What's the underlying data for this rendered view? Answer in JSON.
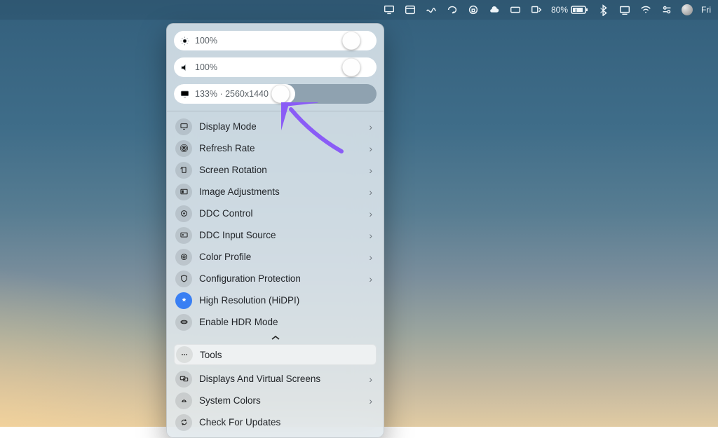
{
  "menubar": {
    "battery_percent": "80%",
    "time_label": "Fri"
  },
  "sliders": {
    "brightness": {
      "value_label": "100%",
      "knob_pct": 92
    },
    "volume": {
      "value_label": "100%",
      "knob_pct": 92
    },
    "resolution": {
      "value_label": "133% · 2560x1440",
      "knob_pct": 57,
      "fill_pct": 60
    }
  },
  "menu": {
    "display_mode": "Display Mode",
    "refresh_rate": "Refresh Rate",
    "screen_rotation": "Screen Rotation",
    "image_adjustments": "Image Adjustments",
    "ddc_control": "DDC Control",
    "ddc_input_source": "DDC Input Source",
    "color_profile": "Color Profile",
    "configuration_protection": "Configuration Protection",
    "high_resolution": "High Resolution (HiDPI)",
    "enable_hdr": "Enable HDR Mode"
  },
  "sections": {
    "tools": "Tools"
  },
  "footer": {
    "displays_virtual": "Displays And Virtual Screens",
    "system_colors": "System Colors",
    "check_updates": "Check For Updates"
  },
  "annotation": {
    "color": "#8a5cf6"
  }
}
